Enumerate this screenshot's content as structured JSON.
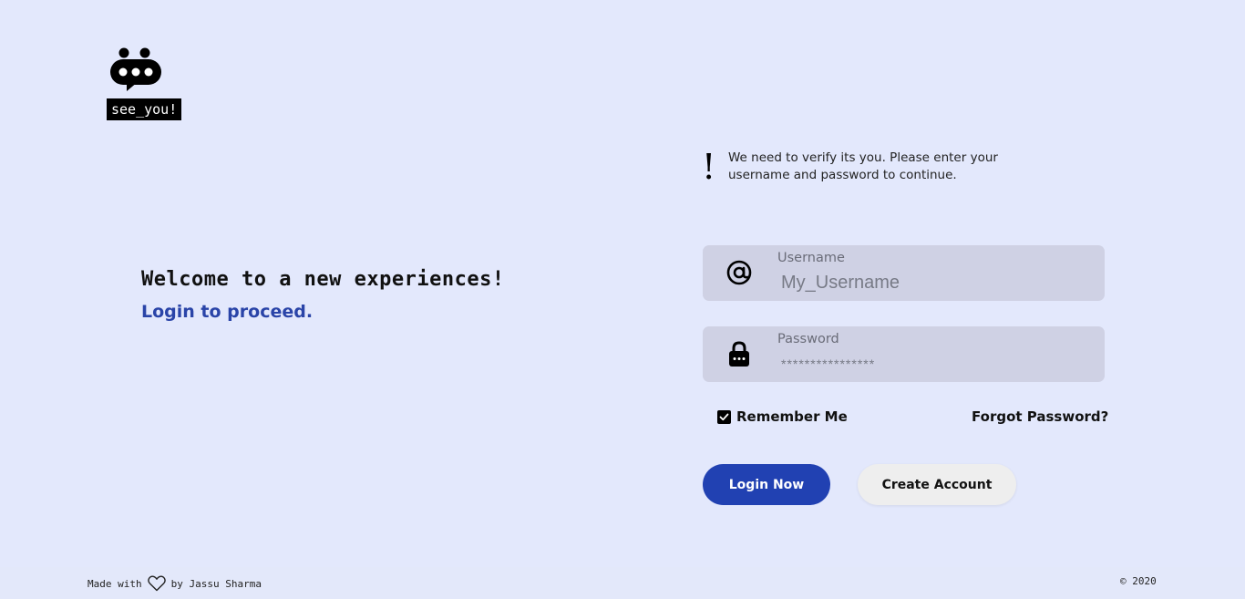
{
  "brand": {
    "name": "see_you!",
    "logo_icon": "speech-bubble-robot-icon"
  },
  "welcome": {
    "heading": "Welcome to a new experiences!",
    "subheading": "Login to proceed."
  },
  "notice": {
    "symbol": "!",
    "message": "We need to verify its you. Please enter your username and password to continue."
  },
  "form": {
    "username": {
      "label": "Username",
      "placeholder": "My_Username",
      "icon": "at-sign-icon"
    },
    "password": {
      "label": "Password",
      "placeholder": "****************",
      "icon": "lock-icon"
    },
    "remember_label": "Remember Me",
    "remember_checked": true,
    "forgot_label": "Forgot Password?",
    "login_label": "Login Now",
    "create_label": "Create Account"
  },
  "footer": {
    "made_with": "Made with",
    "by": "by Jassu Sharma",
    "heart_icon": "heart-icon",
    "copyright": "© 2020"
  },
  "colors": {
    "background": "#e3e8fc",
    "field_background": "#cfd1e4",
    "accent": "#2141b2",
    "link": "#2a44a8",
    "secondary_button": "#eeeeee"
  }
}
